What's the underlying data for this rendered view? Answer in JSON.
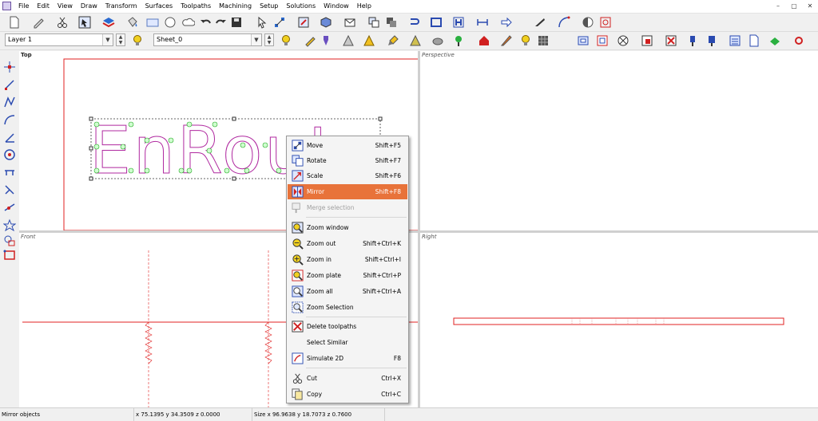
{
  "menubar": {
    "items": [
      "File",
      "Edit",
      "View",
      "Draw",
      "Transform",
      "Surfaces",
      "Toolpaths",
      "Machining",
      "Setup",
      "Solutions",
      "Window",
      "Help"
    ],
    "window_buttons": [
      "–",
      "▢",
      "✕"
    ]
  },
  "toolbar2": {
    "layer_combo": "Layer 1",
    "sheet_combo": "Sheet_0"
  },
  "viewports": {
    "top": "Top",
    "perspective": "Perspective",
    "front": "Front",
    "right": "Right"
  },
  "drawing": {
    "text": "EnRoute",
    "text_color": "#b02aa0"
  },
  "context_menu": {
    "items": [
      {
        "label": "Move",
        "shortcut": "Shift+F5",
        "icon": "move-icon",
        "state": "normal"
      },
      {
        "label": "Rotate",
        "shortcut": "Shift+F7",
        "icon": "rotate-icon",
        "state": "normal"
      },
      {
        "label": "Scale",
        "shortcut": "Shift+F6",
        "icon": "scale-icon",
        "state": "normal"
      },
      {
        "label": "Mirror",
        "shortcut": "Shift+F8",
        "icon": "mirror-icon",
        "state": "highlighted"
      },
      {
        "label": "Merge selection",
        "shortcut": "",
        "icon": "merge-icon",
        "state": "disabled"
      },
      {
        "label": "Zoom window",
        "shortcut": "",
        "icon": "zoom-window-icon",
        "state": "normal"
      },
      {
        "label": "Zoom out",
        "shortcut": "Shift+Ctrl+K",
        "icon": "zoom-out-icon",
        "state": "normal"
      },
      {
        "label": "Zoom in",
        "shortcut": "Shift+Ctrl+I",
        "icon": "zoom-in-icon",
        "state": "normal"
      },
      {
        "label": "Zoom plate",
        "shortcut": "Shift+Ctrl+P",
        "icon": "zoom-plate-icon",
        "state": "normal"
      },
      {
        "label": "Zoom all",
        "shortcut": "Shift+Ctrl+A",
        "icon": "zoom-all-icon",
        "state": "normal"
      },
      {
        "label": "Zoom Selection",
        "shortcut": "",
        "icon": "zoom-selection-icon",
        "state": "normal"
      },
      {
        "label": "Delete toolpaths",
        "shortcut": "",
        "icon": "delete-toolpaths-icon",
        "state": "normal"
      },
      {
        "label": "Select Similar",
        "shortcut": "",
        "icon": "",
        "state": "normal"
      },
      {
        "label": "Simulate 2D",
        "shortcut": "F8",
        "icon": "simulate-icon",
        "state": "normal"
      },
      {
        "label": "Cut",
        "shortcut": "Ctrl+X",
        "icon": "scissors-icon",
        "state": "normal"
      },
      {
        "label": "Copy",
        "shortcut": "Ctrl+C",
        "icon": "copy-icon",
        "state": "normal"
      }
    ]
  },
  "statusbar": {
    "message": "Mirror objects",
    "coords": "x 75.1395 y 34.3509 z 0.0000",
    "size": "Size x 96.9638 y 18.7073 z 0.7600"
  },
  "colors": {
    "accent_highlight": "#e8733a",
    "plate_outline": "#e02020",
    "selection_handle": "#44cc44"
  }
}
